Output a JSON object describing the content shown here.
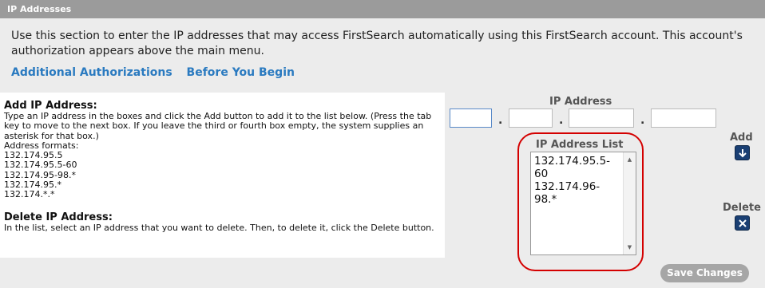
{
  "header": {
    "title": "IP Addresses"
  },
  "intro": {
    "text": "Use this section to enter the IP addresses that may access FirstSearch automatically using this FirstSearch account. This account's authorization appears above the main menu."
  },
  "links": {
    "additional": "Additional Authorizations",
    "before": "Before You Begin"
  },
  "help": {
    "add_title": "Add IP Address:",
    "add_text": "Type an IP address in the boxes and click the Add button to add it to the list below. (Press the tab key to move to the next box. If you leave the third or fourth box empty, the system supplies an asterisk for that box.)",
    "formats_label": "Address formats:",
    "formats": [
      "132.174.95.5",
      "132.174.95.5-60",
      "132.174.95-98.*",
      "132.174.95.*",
      "132.174.*.*"
    ],
    "delete_title": "Delete IP Address:",
    "delete_text": "In the list, select an IP address that you want to delete. Then, to delete it, click the Delete button."
  },
  "ip_input": {
    "label": "IP Address",
    "octets": [
      "",
      "",
      "",
      ""
    ],
    "separator": "."
  },
  "ip_list": {
    "label": "IP Address List",
    "items": [
      "132.174.95.5-60",
      "132.174.96-98.*"
    ]
  },
  "actions": {
    "add_label": "Add",
    "delete_label": "Delete",
    "save_label": "Save Changes"
  },
  "colors": {
    "header_bg": "#9b9b9b",
    "link": "#2a7ac0",
    "icon_button": "#1a3f73",
    "highlight": "#d40000",
    "save_button": "#a6a6a6"
  },
  "icons": {
    "add": "arrow-down-icon",
    "delete": "x-icon"
  }
}
